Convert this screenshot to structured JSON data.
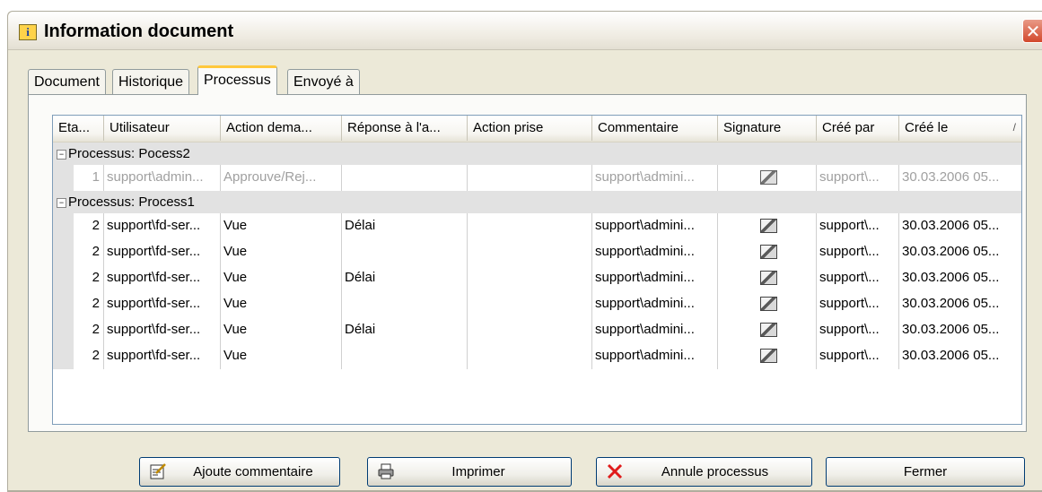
{
  "window": {
    "title": "Information document",
    "close_glyph": "✕"
  },
  "tabs": [
    {
      "label": "Document",
      "active": false
    },
    {
      "label": "Historique",
      "active": false
    },
    {
      "label": "Processus",
      "active": true
    },
    {
      "label": "Envoyé à",
      "active": false
    }
  ],
  "table": {
    "columns": [
      "Eta...",
      "Utilisateur",
      "Action dema...",
      "Réponse à l'a...",
      "Action prise",
      "Commentaire",
      "Signature",
      "Créé par",
      "Créé le"
    ],
    "sort_indicator": "/",
    "groups": [
      {
        "label": "Processus: Pocess2",
        "toggle": "⊟",
        "rows": [
          {
            "etat": "1",
            "utilisateur": "support\\admin...",
            "action": "Approuve/Rej...",
            "reponse": "",
            "action_prise": "",
            "commentaire": "support\\admini...",
            "cree_par": "support\\...",
            "cree_le": "30.03.2006  05...",
            "dim": true
          }
        ]
      },
      {
        "label": "Processus: Process1",
        "toggle": "⊟",
        "rows": [
          {
            "etat": "2",
            "utilisateur": "support\\fd-ser...",
            "action": "Vue",
            "reponse": "Délai",
            "action_prise": "",
            "commentaire": "support\\admini...",
            "cree_par": "support\\...",
            "cree_le": "30.03.2006  05...",
            "dim": false
          },
          {
            "etat": "2",
            "utilisateur": "support\\fd-ser...",
            "action": "Vue",
            "reponse": "",
            "action_prise": "",
            "commentaire": "support\\admini...",
            "cree_par": "support\\...",
            "cree_le": "30.03.2006  05...",
            "dim": false
          },
          {
            "etat": "2",
            "utilisateur": "support\\fd-ser...",
            "action": "Vue",
            "reponse": "Délai",
            "action_prise": "",
            "commentaire": "support\\admini...",
            "cree_par": "support\\...",
            "cree_le": "30.03.2006  05...",
            "dim": false
          },
          {
            "etat": "2",
            "utilisateur": "support\\fd-ser...",
            "action": "Vue",
            "reponse": "",
            "action_prise": "",
            "commentaire": "support\\admini...",
            "cree_par": "support\\...",
            "cree_le": "30.03.2006  05...",
            "dim": false
          },
          {
            "etat": "2",
            "utilisateur": "support\\fd-ser...",
            "action": "Vue",
            "reponse": "Délai",
            "action_prise": "",
            "commentaire": "support\\admini...",
            "cree_par": "support\\...",
            "cree_le": "30.03.2006  05...",
            "dim": false
          },
          {
            "etat": "2",
            "utilisateur": "support\\fd-ser...",
            "action": "Vue",
            "reponse": "",
            "action_prise": "",
            "commentaire": "support\\admini...",
            "cree_par": "support\\...",
            "cree_le": "30.03.2006  05...",
            "dim": false
          }
        ]
      }
    ]
  },
  "buttons": {
    "add_comment": {
      "label": "Ajoute commentaire",
      "icon": "edit-comment-icon"
    },
    "print": {
      "label": "Imprimer",
      "icon": "printer-icon"
    },
    "cancel_process": {
      "label": "Annule processus",
      "icon": "red-x-icon"
    },
    "close": {
      "label": "Fermer"
    }
  },
  "colors": {
    "dialog_bg": "#ece9d8",
    "active_tab_accent": "#ffc83c",
    "group_row_bg": "#e2e2e2",
    "cancel_icon": "#e01b1b",
    "button_border": "#003c74"
  }
}
